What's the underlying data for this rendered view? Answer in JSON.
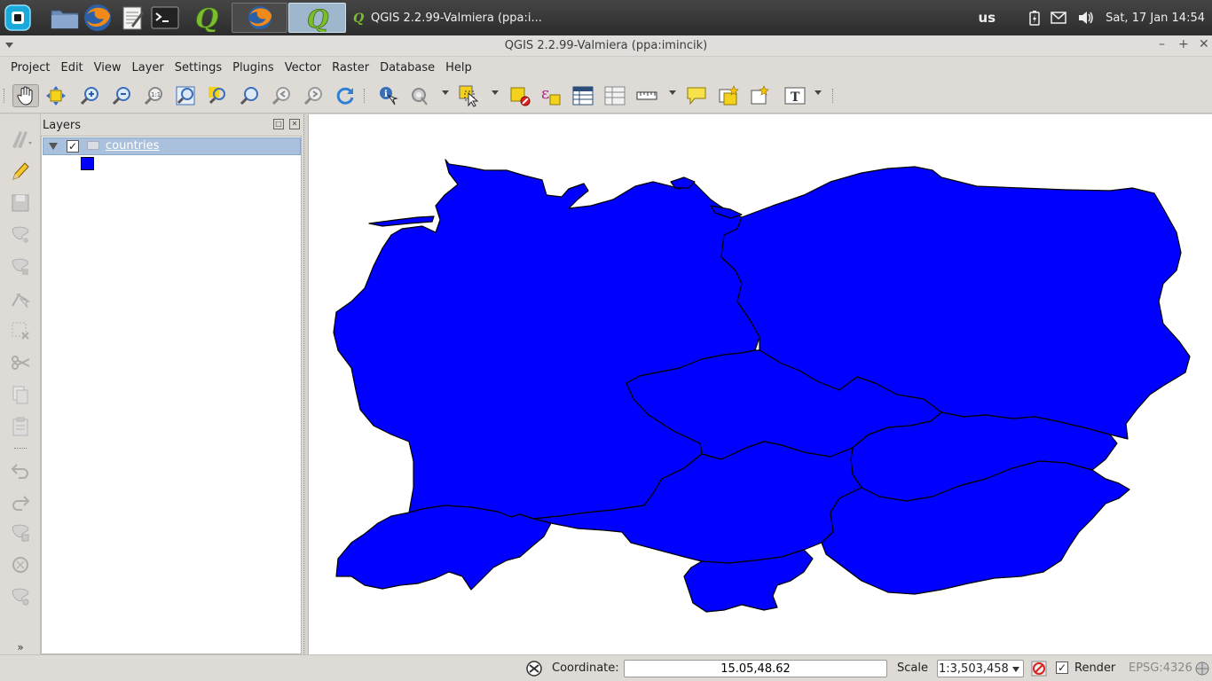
{
  "system_panel": {
    "task_title": "QGIS 2.2.99-Valmiera (ppa:i...",
    "keyboard_layout": "us",
    "clock": "Sat, 17 Jan  14:54"
  },
  "window": {
    "title": "QGIS 2.2.99-Valmiera (ppa:imincik)"
  },
  "menu": [
    {
      "label": "Project",
      "accel": "P"
    },
    {
      "label": "Edit",
      "accel": "E"
    },
    {
      "label": "View",
      "accel": "V"
    },
    {
      "label": "Layer",
      "accel": "L"
    },
    {
      "label": "Settings",
      "accel": "S"
    },
    {
      "label": "Plugins",
      "accel": "P"
    },
    {
      "label": "Vector",
      "accel": "o"
    },
    {
      "label": "Raster",
      "accel": "R"
    },
    {
      "label": "Database",
      "accel": "D"
    },
    {
      "label": "Help",
      "accel": "H"
    }
  ],
  "layers_panel": {
    "title": "Layers",
    "layers": [
      {
        "name": "countries",
        "visible": true,
        "fill_color": "#0000ff"
      }
    ]
  },
  "map": {
    "fill_color": "#0000ff",
    "stroke_color": "#000000",
    "background": "#ffffff"
  },
  "statusbar": {
    "coordinate_label": "Coordinate:",
    "coordinate_value": "15.05,48.62",
    "scale_label": "Scale",
    "scale_value": "1:3,503,458",
    "render_label": "Render",
    "render_checked": true,
    "crs": "EPSG:4326"
  }
}
